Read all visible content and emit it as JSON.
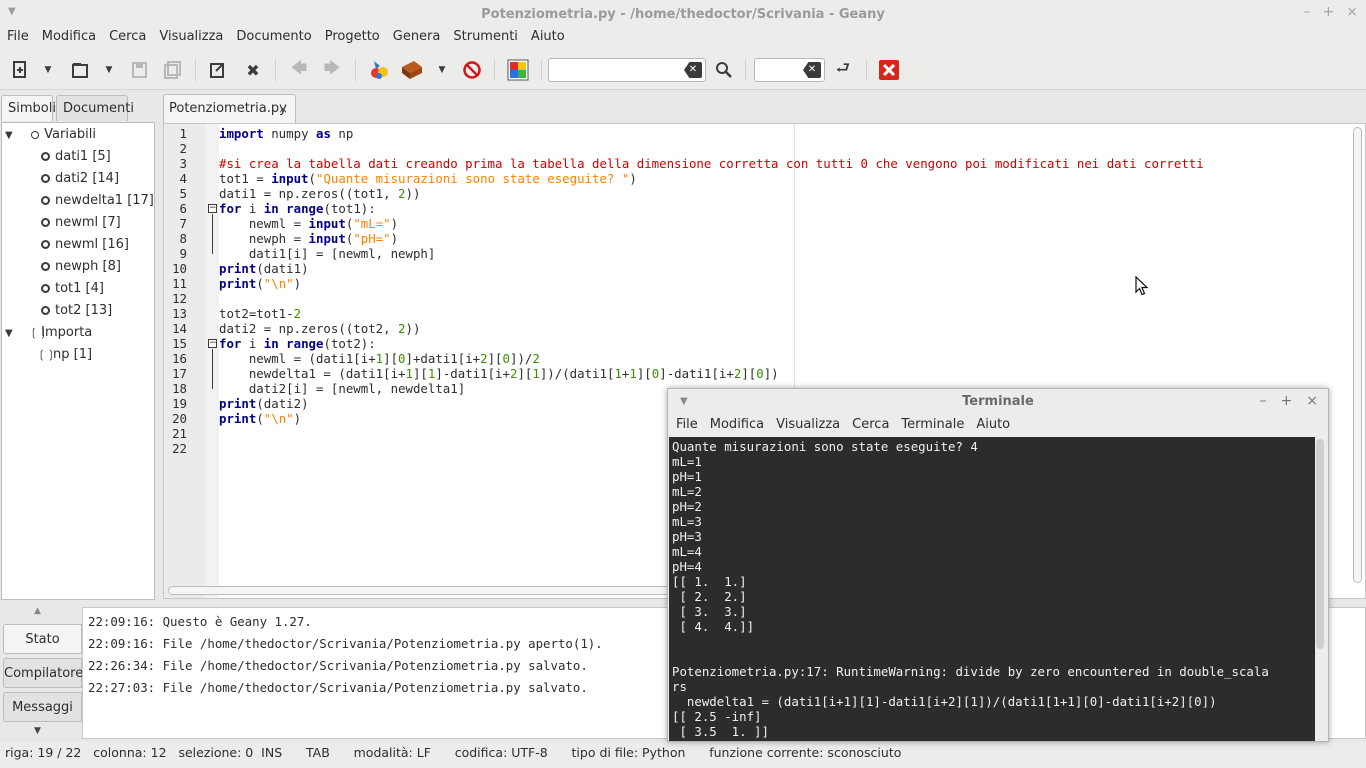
{
  "window": {
    "title": "Potenziometria.py - /home/thedoctor/Scrivania - Geany",
    "controls": [
      "–",
      "+",
      "×"
    ]
  },
  "menubar": [
    "File",
    "Modifica",
    "Cerca",
    "Visualizza",
    "Documento",
    "Progetto",
    "Genera",
    "Strumenti",
    "Aiuto"
  ],
  "toolbar": {
    "icons": [
      "new-file",
      "open-file",
      "save-disabled",
      "save-all-disabled",
      "reload",
      "close",
      "back-disabled",
      "forward-disabled",
      "compile",
      "build",
      "stop",
      "color-chooser",
      "search",
      "goto-line",
      "quit"
    ],
    "search_value": "",
    "line_value": ""
  },
  "sidebar": {
    "tabs": [
      "Simboli",
      "Documenti"
    ],
    "active_tab": "Simboli",
    "tree": [
      {
        "label": "Variabili",
        "level": 0,
        "kind": "group"
      },
      {
        "label": "dati1 [5]",
        "level": 1,
        "kind": "var"
      },
      {
        "label": "dati2 [14]",
        "level": 1,
        "kind": "var"
      },
      {
        "label": "newdelta1 [17]",
        "level": 1,
        "kind": "var"
      },
      {
        "label": "newml [7]",
        "level": 1,
        "kind": "var"
      },
      {
        "label": "newml [16]",
        "level": 1,
        "kind": "var"
      },
      {
        "label": "newph [8]",
        "level": 1,
        "kind": "var"
      },
      {
        "label": "tot1 [4]",
        "level": 1,
        "kind": "var"
      },
      {
        "label": "tot2 [13]",
        "level": 1,
        "kind": "var"
      },
      {
        "label": "Importa",
        "level": 0,
        "kind": "group-import"
      },
      {
        "label": "np [1]",
        "level": 1,
        "kind": "import"
      }
    ]
  },
  "editor": {
    "tab_label": "Potenziometria.py",
    "tab_close": "×",
    "line_numbers": [
      "1",
      "2",
      "3",
      "4",
      "5",
      "6",
      "7",
      "8",
      "9",
      "10",
      "11",
      "12",
      "13",
      "14",
      "15",
      "16",
      "17",
      "18",
      "19",
      "20",
      "21",
      "22"
    ],
    "lines": [
      "import numpy as np",
      "",
      "#si crea la tabella dati creando prima la tabella della dimensione corretta con tutti 0 che vengono poi modificati nei dati corretti",
      "tot1 = input(\"Quante misurazioni sono state eseguite? \")",
      "dati1 = np.zeros((tot1, 2))",
      "for i in range(tot1):",
      "    newml = input(\"mL=\")",
      "    newph = input(\"pH=\")",
      "    dati1[i] = [newml, newph]",
      "print(dati1)",
      "print(\"\\n\")",
      "",
      "tot2=tot1-2",
      "dati2 = np.zeros((tot2, 2))",
      "for i in range(tot2):",
      "    newml = (dati1[i+1][0]+dati1[i+2][0])/2",
      "    newdelta1 = (dati1[i+1][1]-dati1[i+2][1])/(dati1[1+1][0]-dati1[i+2][0])",
      "    dati2[i] = [newml, newdelta1]",
      "print(dati2)",
      "print(\"\\n\")",
      "",
      ""
    ]
  },
  "messages": {
    "tabs": [
      "Stato",
      "Compilatore",
      "Messaggi"
    ],
    "active_tab": "Stato",
    "lines": [
      "22:09:16: Questo è Geany 1.27.",
      "22:09:16: File /home/thedoctor/Scrivania/Potenziometria.py aperto(1).",
      "22:26:34: File /home/thedoctor/Scrivania/Potenziometria.py salvato.",
      "22:27:03: File /home/thedoctor/Scrivania/Potenziometria.py salvato."
    ]
  },
  "statusbar": {
    "text": "riga: 19 / 22   colonna: 12   selezione: 0  INS      TAB      modalità: LF      codifica: UTF-8      tipo di file: Python      funzione corrente: sconosciuto"
  },
  "terminal": {
    "title": "Terminale",
    "controls": [
      "–",
      "+",
      "×"
    ],
    "menu": [
      "File",
      "Modifica",
      "Visualizza",
      "Cerca",
      "Terminale",
      "Aiuto"
    ],
    "lines": [
      "Quante misurazioni sono state eseguite? 4",
      "mL=1",
      "pH=1",
      "mL=2",
      "pH=2",
      "mL=3",
      "pH=3",
      "mL=4",
      "pH=4",
      "[[ 1.  1.]",
      " [ 2.  2.]",
      " [ 3.  3.]",
      " [ 4.  4.]]",
      "",
      "",
      "Potenziometria.py:17: RuntimeWarning: divide by zero encountered in double_scala",
      "rs",
      "  newdelta1 = (dati1[i+1][1]-dati1[i+2][1])/(dati1[1+1][0]-dati1[i+2][0])",
      "[[ 2.5 -inf]",
      " [ 3.5  1. ]]"
    ]
  }
}
